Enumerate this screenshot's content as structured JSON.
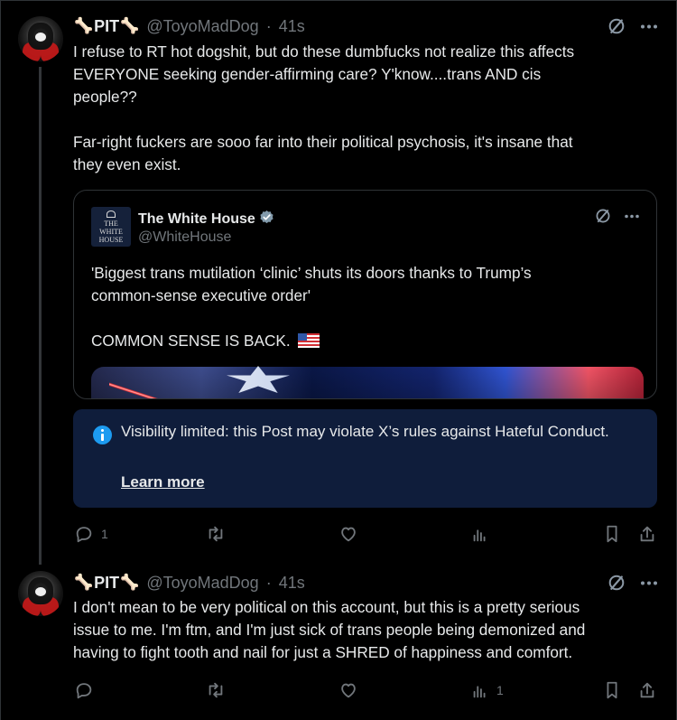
{
  "posts": [
    {
      "author": {
        "name": "PIT",
        "bone_left": "🦴",
        "bone_right": "🦴",
        "handle": "@ToyoMadDog",
        "separator": "·",
        "time": "41s"
      },
      "text_lines": [
        "I refuse to RT hot dogshit, but do these dumbfucks not realize this affects",
        "EVERYONE seeking gender-affirming care? Y'know....trans AND cis",
        "people??",
        "",
        "Far-right fuckers are sooo far into their political psychosis, it's insane that",
        "they even exist."
      ],
      "quote": {
        "author_name": "The White House",
        "author_handle": "@WhiteHouse",
        "logo_lines": [
          "THE",
          "WHITE",
          "HOUSE"
        ],
        "text_lines": [
          "'Biggest trans mutilation ‘clinic’ shuts its doors thanks to Trump’s",
          "common-sense executive order'",
          "",
          "COMMON SENSE IS BACK."
        ]
      },
      "notice": {
        "text": "Visibility limited: this Post may violate X’s rules against Hateful Conduct.",
        "link_text": "Learn more"
      },
      "metrics": {
        "replies": "1",
        "reposts": "",
        "likes": "",
        "views": ""
      }
    },
    {
      "author": {
        "name": "PIT",
        "bone_left": "🦴",
        "bone_right": "🦴",
        "handle": "@ToyoMadDog",
        "separator": "·",
        "time": "41s"
      },
      "text_lines": [
        "I don't mean to be very political on this account, but this is a pretty serious",
        "issue to me. I'm ftm, and I'm just sick of trans people being demonized and",
        "having to fight tooth and nail for just a SHRED of happiness and comfort."
      ],
      "metrics": {
        "replies": "",
        "reposts": "",
        "likes": "",
        "views": "1"
      }
    }
  ],
  "icons": {
    "grok": "grok-icon",
    "more": "more-icon",
    "verified": "verified-badge-icon",
    "reply": "reply-icon",
    "repost": "repost-icon",
    "like": "like-icon",
    "views": "views-icon",
    "bookmark": "bookmark-icon",
    "share": "share-icon",
    "info": "info-icon"
  },
  "colors": {
    "background": "#000000",
    "text": "#e7e9ea",
    "muted": "#71767b",
    "accent": "#1d9bf0",
    "notice_background": "#0f1d3b"
  }
}
